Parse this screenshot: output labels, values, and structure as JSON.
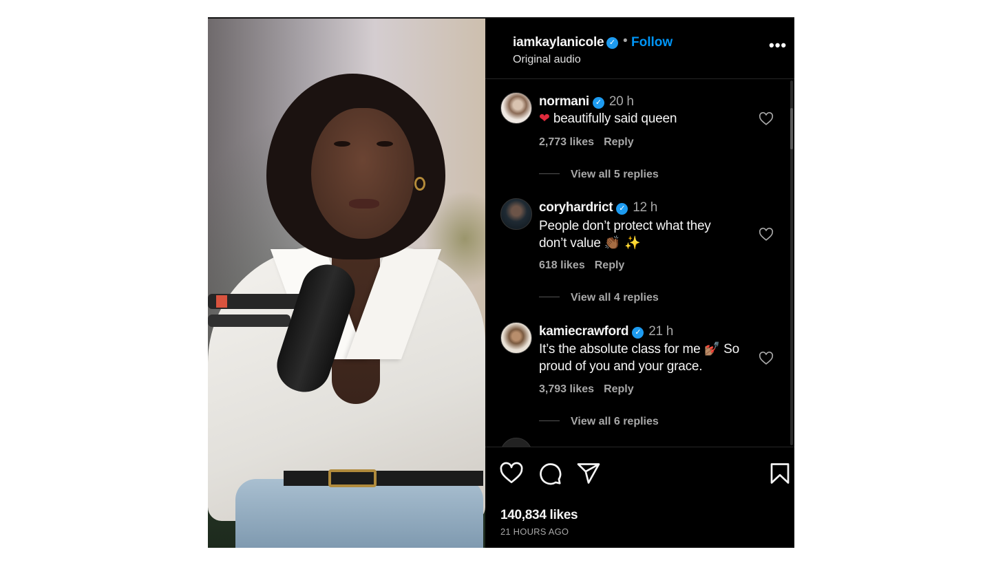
{
  "post": {
    "author": {
      "username": "iamkaylanicole",
      "verified": true,
      "separator": "•",
      "follow_label": "Follow",
      "audio": "Original audio"
    },
    "more_label": "•••",
    "comments": [
      {
        "username": "normani",
        "verified": true,
        "time": "20 h",
        "emoji": "❤️",
        "text": "beautifully said queen",
        "likes": "2,773 likes",
        "reply_label": "Reply",
        "view_replies": "View all 5 replies"
      },
      {
        "username": "coryhardrict",
        "verified": true,
        "time": "12 h",
        "text_line1": "People don’t protect what they",
        "text_line2": "don’t value",
        "emoji": "👏🏾 ✨",
        "likes": "618 likes",
        "reply_label": "Reply",
        "view_replies": "View all 4 replies"
      },
      {
        "username": "kamiecrawford",
        "verified": true,
        "time": "21 h",
        "text_line1": "It’s the absolute class for me",
        "emoji": "💅🏽",
        "text_line1b": "So",
        "text_line2": "proud of you and your grace.",
        "likes": "3,793 likes",
        "reply_label": "Reply",
        "view_replies": "View all 6 replies"
      }
    ],
    "total_likes": "140,834 likes",
    "posted_ago": "21 HOURS AGO"
  },
  "icons": {
    "verified": "verified-badge-icon",
    "heart": "heart-icon",
    "comment": "comment-icon",
    "share": "send-icon",
    "save": "bookmark-icon",
    "more": "more-options-icon"
  },
  "colors": {
    "background": "#000000",
    "follow": "#0095f6",
    "muted": "#a8a8a8",
    "verified": "#1d9bf0"
  }
}
